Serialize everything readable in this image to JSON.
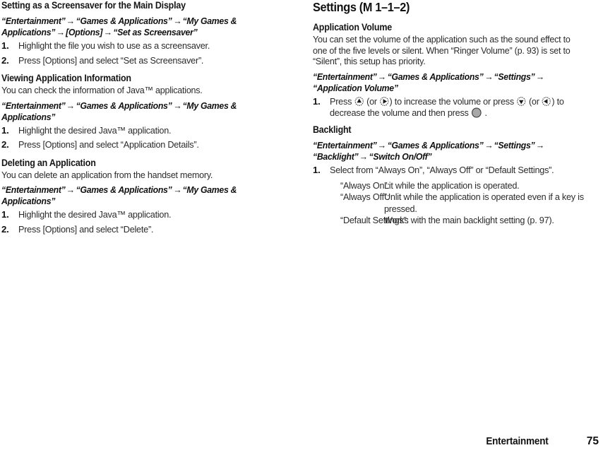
{
  "footer": {
    "section": "Entertainment",
    "page": "75"
  },
  "left_column": {
    "sections": [
      {
        "id": "screensaver",
        "heading": "Setting as a Screensaver for the Main Display",
        "intro": "",
        "path": [
          "“Entertainment”",
          "“Games & Applications”",
          "“My Games & Applications”",
          "[Options]",
          "“Set as Screensaver”"
        ],
        "steps": [
          {
            "num": "1.",
            "text": "Highlight the file you wish to use as a screensaver."
          },
          {
            "num": "2.",
            "text": "Press [Options] and select “Set as Screensaver”."
          }
        ]
      },
      {
        "id": "viewing-application-information",
        "heading": "Viewing Application Information",
        "intro": "You can check the information of Java™ applications.",
        "path": [
          "“Entertainment”",
          "“Games & Applications”",
          "“My Games & Applications”"
        ],
        "steps": [
          {
            "num": "1.",
            "text": "Highlight the desired Java™ application."
          },
          {
            "num": "2.",
            "text": "Press [Options] and select “Application Details”."
          }
        ]
      },
      {
        "id": "deleting-an-application",
        "heading": "Deleting an Application",
        "intro": "You can delete an application from the handset memory.",
        "path": [
          "“Entertainment”",
          "“Games & Applications”",
          "“My Games & Applications”"
        ],
        "steps": [
          {
            "num": "1.",
            "text": "Highlight the desired Java™ application."
          },
          {
            "num": "2.",
            "text": "Press [Options] and select “Delete”."
          }
        ]
      }
    ]
  },
  "right_column": {
    "title": "Settings (M 1–1–2)",
    "sections": [
      {
        "id": "application-volume",
        "heading": "Application Volume",
        "intro": "You can set the volume of the application such as the sound effect to one of the five levels or silent. When “Ringer Volume” (p. 93) is set to “Silent”, this setup has priority.",
        "path": [
          "“Entertainment”",
          "“Games & Applications”",
          "“Settings”",
          "“Application Volume”"
        ],
        "step": {
          "num": "1.",
          "parts": [
            {
              "type": "text",
              "value": "Press "
            },
            {
              "type": "key",
              "value": "nav-up-key-icon"
            },
            {
              "type": "text",
              "value": " (or "
            },
            {
              "type": "key",
              "value": "nav-right-key-icon"
            },
            {
              "type": "text",
              "value": ") to increase the volume or press "
            },
            {
              "type": "key",
              "value": "nav-down-key-icon"
            },
            {
              "type": "text",
              "value": " (or "
            },
            {
              "type": "key",
              "value": "nav-left-key-icon"
            },
            {
              "type": "text",
              "value": ") to decrease the volume and then press "
            },
            {
              "type": "key",
              "value": "center-select-key-icon"
            },
            {
              "type": "text",
              "value": " ."
            }
          ]
        }
      },
      {
        "id": "backlight",
        "heading": "Backlight",
        "intro": "",
        "path": [
          "“Entertainment”",
          "“Games & Applications”",
          "“Settings”",
          "“Backlight”",
          "“Switch On/Off”"
        ],
        "steps": [
          {
            "num": "1.",
            "text": "Select from “Always On”, “Always Off” or “Default Settings”."
          }
        ],
        "definitions": [
          {
            "term": "“Always On”:",
            "desc": "Lit while the application is operated."
          },
          {
            "term": "“Always Off”:",
            "desc": "Unlit while the application is operated even if a key is pressed."
          },
          {
            "term": "“Default Settings”:",
            "desc": "Works with the main backlight setting (p. 97)."
          }
        ]
      }
    ]
  },
  "colors": {
    "text": "#1a1a1a",
    "body_text": "#2b2b2b",
    "key_fill": "#a8a8a8",
    "background": "#ffffff"
  },
  "symbols": {
    "arrow": "→"
  }
}
